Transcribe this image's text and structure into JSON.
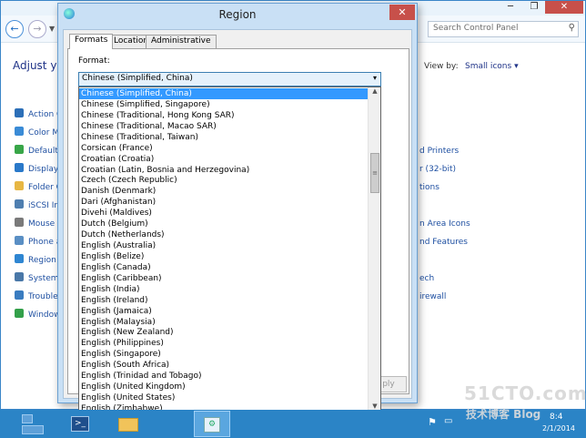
{
  "control_panel": {
    "search_placeholder": "Search Control Panel",
    "heading": "Adjust yo",
    "view_by_label": "View by:",
    "view_by_value": "Small icons",
    "window_buttons": {
      "minimize": "─",
      "maximize": "❐",
      "close": "✕"
    },
    "left_items": [
      {
        "label": "Action C",
        "icon_color": "#2c6fb8"
      },
      {
        "label": "Color M",
        "icon_color": "#3a8bd6"
      },
      {
        "label": "Default",
        "icon_color": "#38a648"
      },
      {
        "label": "Display",
        "icon_color": "#2a79c9"
      },
      {
        "label": "Folder O",
        "icon_color": "#e7b744"
      },
      {
        "label": "iSCSI Ini",
        "icon_color": "#4f7fb0"
      },
      {
        "label": "Mouse",
        "icon_color": "#7a7a7a"
      },
      {
        "label": "Phone a",
        "icon_color": "#5a8fc4"
      },
      {
        "label": "Region",
        "icon_color": "#2f86d2"
      },
      {
        "label": "System",
        "icon_color": "#4a78a8"
      },
      {
        "label": "Trouble",
        "icon_color": "#3a7cc0"
      },
      {
        "label": "Window",
        "icon_color": "#33a04a"
      }
    ],
    "right_items": [
      "d Printers",
      "r (32-bit)",
      "tions",
      "n Area Icons",
      "nd Features",
      "ech",
      "irewall"
    ]
  },
  "dialog": {
    "title": "Region",
    "close": "✕",
    "tabs": [
      "Formats",
      "Location",
      "Administrative"
    ],
    "format_label": "Format:",
    "format_value": "Chinese (Simplified, China)",
    "apply_label": "ply"
  },
  "dropdown": {
    "selected_index": 0,
    "items": [
      "Chinese (Simplified, China)",
      "Chinese (Simplified, Singapore)",
      "Chinese (Traditional, Hong Kong SAR)",
      "Chinese (Traditional, Macao SAR)",
      "Chinese (Traditional, Taiwan)",
      "Corsican (France)",
      "Croatian (Croatia)",
      "Croatian (Latin, Bosnia and Herzegovina)",
      "Czech (Czech Republic)",
      "Danish (Denmark)",
      "Dari (Afghanistan)",
      "Divehi (Maldives)",
      "Dutch (Belgium)",
      "Dutch (Netherlands)",
      "English (Australia)",
      "English (Belize)",
      "English (Canada)",
      "English (Caribbean)",
      "English (India)",
      "English (Ireland)",
      "English (Jamaica)",
      "English (Malaysia)",
      "English (New Zealand)",
      "English (Philippines)",
      "English (Singapore)",
      "English (South Africa)",
      "English (Trinidad and Tobago)",
      "English (United Kingdom)",
      "English (United States)",
      "English (Zimbabwe)"
    ]
  },
  "taskbar": {
    "powershell_glyph": ">_",
    "tray_time": "8:4",
    "tray_date": "2/1/2014"
  },
  "watermark": {
    "text": "51CTO.com",
    "subtext": "技术博客 Blog"
  }
}
